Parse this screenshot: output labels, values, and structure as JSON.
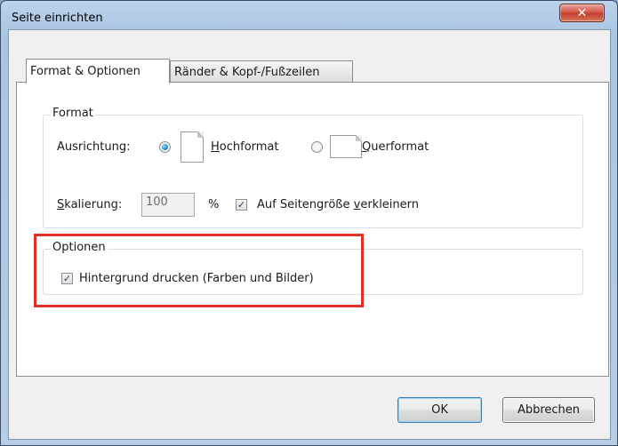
{
  "window": {
    "title": "Seite einrichten",
    "close_symbol": "✕"
  },
  "tabs": [
    {
      "label": "Format & Optionen",
      "active": true
    },
    {
      "label": "Ränder & Kopf-/Fußzeilen",
      "active": false
    }
  ],
  "format_group": {
    "title": "Format",
    "orientation_label": "Ausrichtung:",
    "portrait": {
      "prefix": "",
      "accel": "H",
      "rest": "ochformat",
      "selected": true
    },
    "landscape": {
      "prefix": "",
      "accel": "Q",
      "rest": "uerformat",
      "selected": false
    },
    "scaling_label_accel": "S",
    "scaling_label_rest": "kalierung:",
    "scaling_value": "100",
    "percent": "%",
    "shrink_label_before": "Auf Seitengröße ",
    "shrink_label_accel": "v",
    "shrink_label_after": "erkleinern",
    "shrink_checked": true
  },
  "options_group": {
    "title": "Optionen",
    "background_label": "Hintergrund drucken (Farben und Bilder)",
    "background_checked": true
  },
  "buttons": {
    "ok": "OK",
    "cancel": "Abbrechen"
  },
  "check_glyph": "✓",
  "colors": {
    "highlight": "#e3312a",
    "close_button": "#c2402f"
  }
}
